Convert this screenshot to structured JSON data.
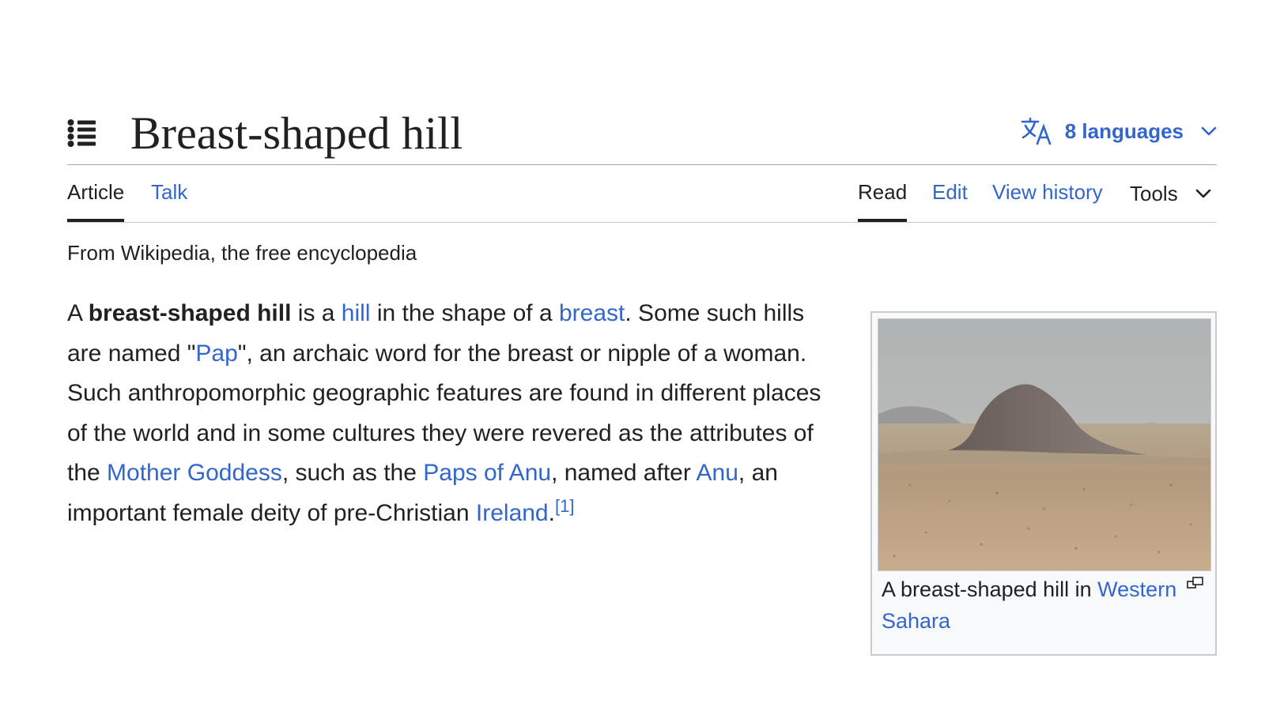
{
  "header": {
    "title": "Breast-shaped hill",
    "languages_label": "8 languages"
  },
  "tabs": {
    "article": "Article",
    "talk": "Talk",
    "read": "Read",
    "edit": "Edit",
    "view_history": "View history",
    "tools": "Tools"
  },
  "site_sub": "From Wikipedia, the free encyclopedia",
  "lead": {
    "p1": "A ",
    "term": "breast-shaped hill",
    "p2": " is a ",
    "link_hill": "hill",
    "p3": " in the shape of a ",
    "link_breast": "breast",
    "p4": ". Some such hills are named \"",
    "link_pap": "Pap",
    "p5": "\", an archaic word for the breast or nipple of a woman. Such anthropomorphic geographic features are found in different places of the world and in some cultures they were revered as the attributes of the ",
    "link_mother_goddess": "Mother Goddess",
    "p6": ", such as the ",
    "link_paps_of_anu": "Paps of Anu",
    "p7": ", named after ",
    "link_anu": "Anu",
    "p8": ", an important female deity of pre-Christian ",
    "link_ireland": "Ireland",
    "p9": ".",
    "ref": "[1]"
  },
  "infobox": {
    "caption_text": "A breast-shaped hill in ",
    "caption_link": "Western Sahara"
  },
  "icons": {
    "toc": "list-bullet-icon",
    "language": "translate-icon",
    "chevron": "chevron-down-icon",
    "magnify": "enlarge-icon"
  },
  "colors": {
    "link": "#3366cc",
    "text": "#202122",
    "border": "#a2a9b1",
    "thumb_background": "#f8f9fa"
  }
}
